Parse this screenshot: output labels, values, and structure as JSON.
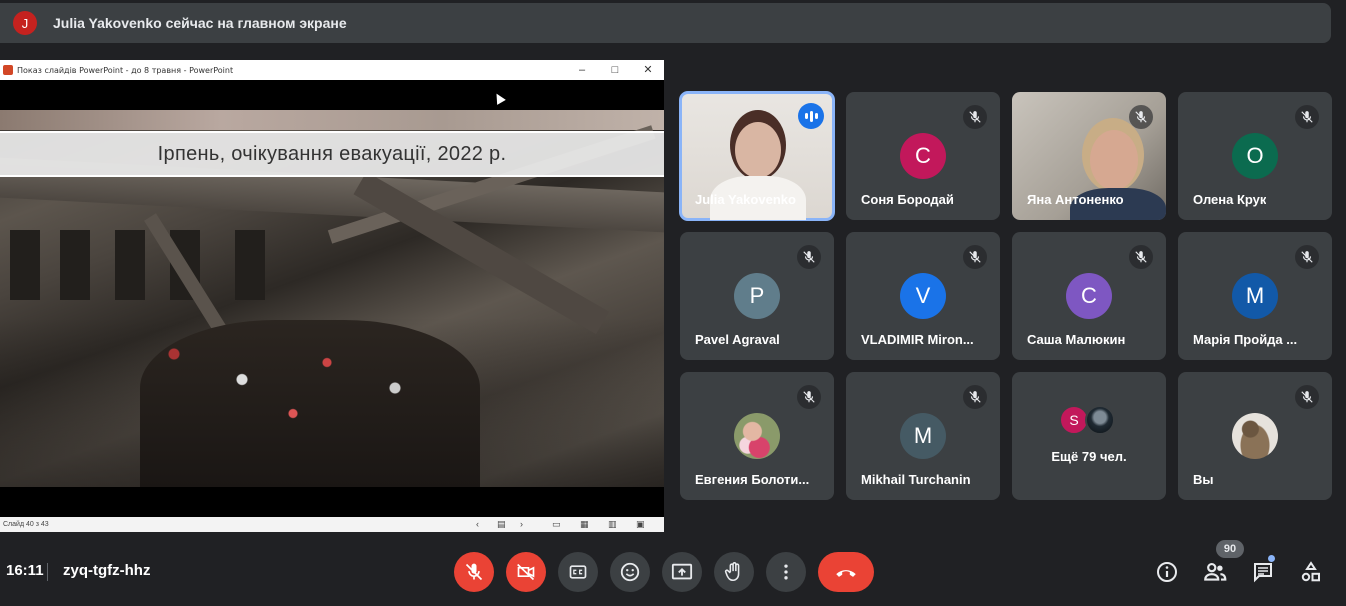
{
  "banner": {
    "avatar_letter": "J",
    "text": "Julia Yakovenko сейчас на главном экране"
  },
  "presentation": {
    "window_title": "Показ слайдів PowerPoint  -  до 8 травня - PowerPoint",
    "slide_title": "Ірпень, очікування евакуації, 2022 р.",
    "status": "Слайд 40 з 43"
  },
  "participants": [
    {
      "name": "Julia Yakovenko",
      "type": "photo",
      "speaking": true
    },
    {
      "name": "Соня Бородай",
      "letter": "С",
      "color": "#c2185b"
    },
    {
      "name": "Яна Антоненко",
      "type": "photo",
      "muted": true
    },
    {
      "name": "Олена Крук",
      "letter": "О",
      "color": "#0b6b4f"
    },
    {
      "name": "Pavel Agraval",
      "letter": "P",
      "color": "#607d8b"
    },
    {
      "name": "VLADIMIR Miron...",
      "letter": "V",
      "color": "#1a73e8"
    },
    {
      "name": "Саша Малюкин",
      "letter": "С",
      "color": "#7e57c2"
    },
    {
      "name": "Марія Пройда ...",
      "letter": "М",
      "color": "#1259a8"
    },
    {
      "name": "Евгения Болоти...",
      "type": "pic"
    },
    {
      "name": "Mikhail Turchanin",
      "letter": "M",
      "color": "#455a64"
    },
    {
      "name": "Ещё 79 чел.",
      "type": "more",
      "letter": "S"
    },
    {
      "name": "Вы",
      "type": "pic2"
    }
  ],
  "bottom": {
    "time": "16:11",
    "meeting_code": "zyq-tgfz-hhz",
    "people_count": "90"
  },
  "colors": {
    "accent": "#8ab4f8",
    "danger": "#ea4335",
    "tile": "#3c4043",
    "background": "#202124"
  }
}
